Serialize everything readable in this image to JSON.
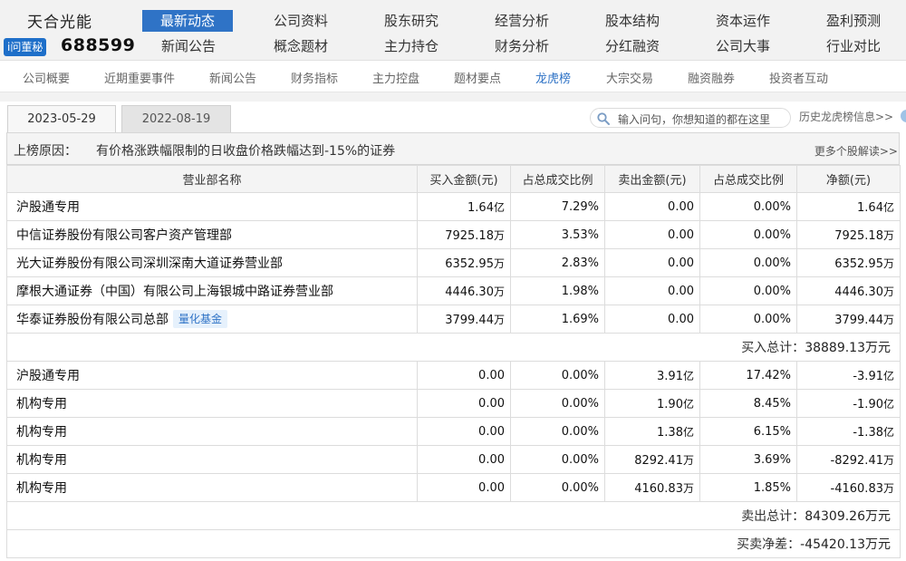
{
  "brand": {
    "stock_name": "天合光能",
    "ask_badge": "i问董秘",
    "stock_code": "688599"
  },
  "nav": [
    {
      "label": "最新动态",
      "active": true
    },
    {
      "label": "公司资料"
    },
    {
      "label": "股东研究"
    },
    {
      "label": "经营分析"
    },
    {
      "label": "股本结构"
    },
    {
      "label": "资本运作"
    },
    {
      "label": "盈利预测"
    },
    {
      "label": "新闻公告"
    },
    {
      "label": "概念题材"
    },
    {
      "label": "主力持仓"
    },
    {
      "label": "财务分析"
    },
    {
      "label": "分红融资"
    },
    {
      "label": "公司大事"
    },
    {
      "label": "行业对比"
    }
  ],
  "subnav": [
    {
      "label": "公司概要"
    },
    {
      "label": "近期重要事件"
    },
    {
      "label": "新闻公告"
    },
    {
      "label": "财务指标"
    },
    {
      "label": "主力控盘"
    },
    {
      "label": "题材要点"
    },
    {
      "label": "龙虎榜",
      "active": true
    },
    {
      "label": "大宗交易"
    },
    {
      "label": "融资融券"
    },
    {
      "label": "投资者互动"
    }
  ],
  "date_tabs": [
    {
      "label": "2023-05-29",
      "active": true
    },
    {
      "label": "2022-08-19"
    }
  ],
  "search": {
    "placeholder": "输入问句，你想知道的都在这里",
    "icon": "search-icon"
  },
  "history_link": "历史龙虎榜信息>>",
  "reason": {
    "label": "上榜原因：",
    "text": "有价格涨跌幅限制的日收盘价格跌幅达到-15%的证券",
    "more": "更多个股解读>>"
  },
  "table": {
    "headers": [
      "营业部名称",
      "买入金额(元)",
      "占总成交比例",
      "卖出金额(元)",
      "占总成交比例",
      "净额(元)"
    ],
    "buy_rows": [
      {
        "name": "沪股通专用",
        "buy": "1.64",
        "buy_unit": "亿",
        "buy_pct": "7.29%",
        "sell": "0.00",
        "sell_unit": "",
        "sell_pct": "0.00%",
        "net": "1.64",
        "net_unit": "亿"
      },
      {
        "name": "中信证券股份有限公司客户资产管理部",
        "buy": "7925.18",
        "buy_unit": "万",
        "buy_pct": "3.53%",
        "sell": "0.00",
        "sell_unit": "",
        "sell_pct": "0.00%",
        "net": "7925.18",
        "net_unit": "万"
      },
      {
        "name": "光大证券股份有限公司深圳深南大道证券营业部",
        "buy": "6352.95",
        "buy_unit": "万",
        "buy_pct": "2.83%",
        "sell": "0.00",
        "sell_unit": "",
        "sell_pct": "0.00%",
        "net": "6352.95",
        "net_unit": "万"
      },
      {
        "name": "摩根大通证券（中国）有限公司上海银城中路证券营业部",
        "buy": "4446.30",
        "buy_unit": "万",
        "buy_pct": "1.98%",
        "sell": "0.00",
        "sell_unit": "",
        "sell_pct": "0.00%",
        "net": "4446.30",
        "net_unit": "万"
      },
      {
        "name": "华泰证券股份有限公司总部",
        "tag": "量化基金",
        "buy": "3799.44",
        "buy_unit": "万",
        "buy_pct": "1.69%",
        "sell": "0.00",
        "sell_unit": "",
        "sell_pct": "0.00%",
        "net": "3799.44",
        "net_unit": "万"
      }
    ],
    "buy_total_label": "买入总计：",
    "buy_total_value": "38889.13万元",
    "sell_rows": [
      {
        "name": "沪股通专用",
        "buy": "0.00",
        "buy_unit": "",
        "buy_pct": "0.00%",
        "sell": "3.91",
        "sell_unit": "亿",
        "sell_pct": "17.42%",
        "net": "-3.91",
        "net_unit": "亿"
      },
      {
        "name": "机构专用",
        "buy": "0.00",
        "buy_unit": "",
        "buy_pct": "0.00%",
        "sell": "1.90",
        "sell_unit": "亿",
        "sell_pct": "8.45%",
        "net": "-1.90",
        "net_unit": "亿"
      },
      {
        "name": "机构专用",
        "buy": "0.00",
        "buy_unit": "",
        "buy_pct": "0.00%",
        "sell": "1.38",
        "sell_unit": "亿",
        "sell_pct": "6.15%",
        "net": "-1.38",
        "net_unit": "亿"
      },
      {
        "name": "机构专用",
        "buy": "0.00",
        "buy_unit": "",
        "buy_pct": "0.00%",
        "sell": "8292.41",
        "sell_unit": "万",
        "sell_pct": "3.69%",
        "net": "-8292.41",
        "net_unit": "万"
      },
      {
        "name": "机构专用",
        "buy": "0.00",
        "buy_unit": "",
        "buy_pct": "0.00%",
        "sell": "4160.83",
        "sell_unit": "万",
        "sell_pct": "1.85%",
        "net": "-4160.83",
        "net_unit": "万"
      }
    ],
    "sell_total_label": "卖出总计：",
    "sell_total_value": "84309.26万元",
    "net_total_label": "买卖净差：",
    "net_total_value": "-45420.13万元"
  },
  "colors": {
    "accent": "#2f73c6",
    "header_bg": "#f2f2f2",
    "tag_bg": "#e6f1fc"
  }
}
